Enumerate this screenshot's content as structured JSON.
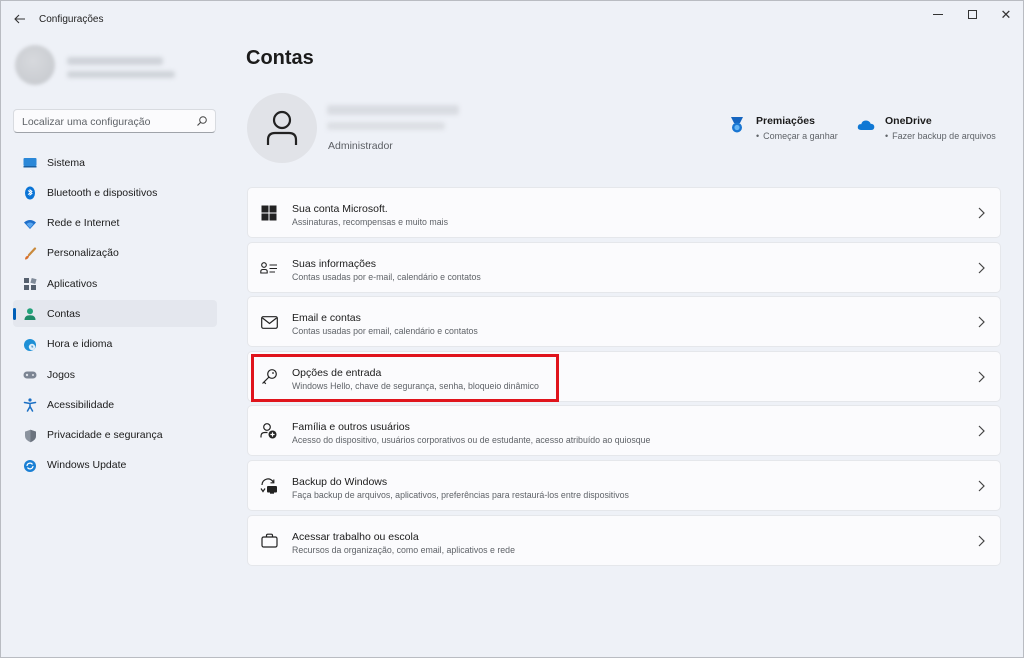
{
  "window": {
    "title": "Configurações"
  },
  "sidebar": {
    "search_placeholder": "Localizar uma configuração",
    "items": [
      {
        "label": "Sistema",
        "icon": "monitor-icon",
        "active": false
      },
      {
        "label": "Bluetooth e dispositivos",
        "icon": "bluetooth-icon",
        "active": false
      },
      {
        "label": "Rede e Internet",
        "icon": "wifi-icon",
        "active": false
      },
      {
        "label": "Personalização",
        "icon": "brush-icon",
        "active": false
      },
      {
        "label": "Aplicativos",
        "icon": "apps-icon",
        "active": false
      },
      {
        "label": "Contas",
        "icon": "person-icon",
        "active": true
      },
      {
        "label": "Hora e idioma",
        "icon": "globe-clock-icon",
        "active": false
      },
      {
        "label": "Jogos",
        "icon": "gamepad-icon",
        "active": false
      },
      {
        "label": "Acessibilidade",
        "icon": "accessibility-icon",
        "active": false
      },
      {
        "label": "Privacidade e segurança",
        "icon": "shield-icon",
        "active": false
      },
      {
        "label": "Windows Update",
        "icon": "update-icon",
        "active": false
      }
    ]
  },
  "main": {
    "title": "Contas",
    "account": {
      "role": "Administrador"
    },
    "promos": [
      {
        "title": "Premiações",
        "subtitle": "Começar a ganhar",
        "icon": "medal-icon"
      },
      {
        "title": "OneDrive",
        "subtitle": "Fazer backup de arquivos",
        "icon": "cloud-icon"
      }
    ],
    "cards": [
      {
        "title": "Sua conta Microsoft.",
        "subtitle": "Assinaturas, recompensas e muito mais",
        "icon": "windows-logo-icon"
      },
      {
        "title": "Suas informações",
        "subtitle": "Contas usadas por e-mail, calendário e contatos",
        "icon": "person-card-icon"
      },
      {
        "title": "Email e contas",
        "subtitle": "Contas usadas por email, calendário e contatos",
        "icon": "mail-icon"
      },
      {
        "title": "Opções de entrada",
        "subtitle": "Windows Hello, chave de segurança, senha, bloqueio dinâmico",
        "icon": "key-icon"
      },
      {
        "title": "Família e outros usuários",
        "subtitle": "Acesso do dispositivo, usuários corporativos ou de estudante, acesso atribuído ao quiosque",
        "icon": "family-icon"
      },
      {
        "title": "Backup do Windows",
        "subtitle": "Faça backup de arquivos, aplicativos, preferências para restaurá-los entre dispositivos",
        "icon": "backup-icon"
      },
      {
        "title": "Acessar trabalho ou escola",
        "subtitle": "Recursos da organização, como email, aplicativos e rede",
        "icon": "briefcase-icon"
      }
    ]
  },
  "colors": {
    "accent": "#005fb8",
    "highlight": "#e0141c",
    "background": "#eef1f7",
    "card": "#fbfbfd"
  }
}
